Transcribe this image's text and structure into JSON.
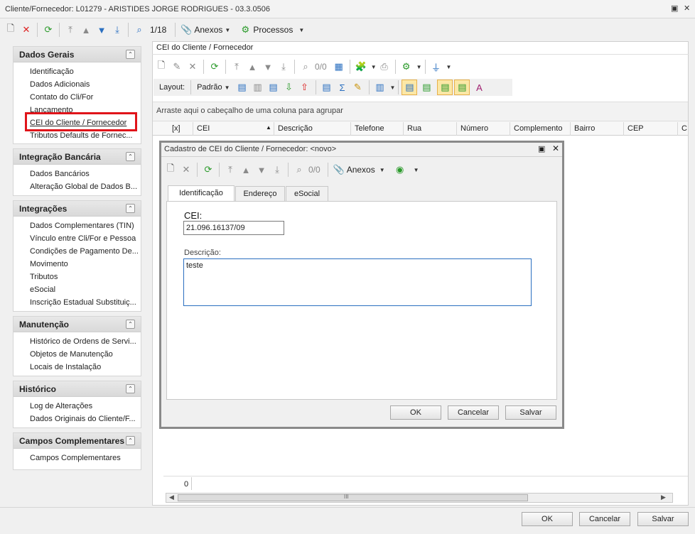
{
  "window": {
    "title": "Cliente/Fornecedor: L01279 - ARISTIDES JORGE RODRIGUES - 03.3.0506"
  },
  "toolbar": {
    "record_counter": "1/18",
    "attachments_label": "Anexos",
    "processes_label": "Processos"
  },
  "sidebar": {
    "groups": [
      {
        "title": "Dados Gerais",
        "items": [
          "Identificação",
          "Dados Adicionais",
          "Contato do Cli/For",
          "Lancamento",
          "CEI do Cliente  /  Fornecedor",
          "Tributos Defaults de Fornec..."
        ]
      },
      {
        "title": "Integração Bancária",
        "items": [
          "Dados Bancários",
          "Alteração Global de Dados B..."
        ]
      },
      {
        "title": "Integrações",
        "items": [
          "Dados Complementares (TIN)",
          "Vínculo entre Cli/For e Pessoa",
          "Condições de Pagamento De...",
          "Movimento",
          "Tributos",
          "eSocial",
          "Inscrição Estadual Substituiç..."
        ]
      },
      {
        "title": "Manutenção",
        "items": [
          "Histórico de Ordens de Servi...",
          "Objetos de Manutenção",
          "Locais de Instalação"
        ]
      },
      {
        "title": "Histórico",
        "items": [
          "Log de Alterações",
          "Dados Originais do Cliente/F..."
        ]
      },
      {
        "title": "Campos Complementares",
        "items": [
          "Campos Complementares"
        ]
      }
    ]
  },
  "panel": {
    "title": "CEI do Cliente  /  Fornecedor",
    "record_counter": "0/0",
    "layout_label": "Layout:",
    "layout_value": "Padrão",
    "group_hint": "Arraste aqui o cabeçalho de uma coluna para agrupar",
    "columns": [
      "[x]",
      "CEI",
      "Descrição",
      "Telefone",
      "Rua",
      "Número",
      "Complemento",
      "Bairro",
      "CEP",
      "C"
    ],
    "footer_count": "0",
    "scroll_thumb": "III"
  },
  "dialog": {
    "title": "Cadastro de CEI do Cliente / Fornecedor: <novo>",
    "record_counter": "0/0",
    "attachments_label": "Anexos",
    "tabs": [
      "Identificação",
      "Endereço",
      "eSocial"
    ],
    "cei_label": "CEI:",
    "cei_value": "21.096.16137/09",
    "descricao_label": "Descrição:",
    "descricao_value": "teste",
    "ok": "OK",
    "cancel": "Cancelar",
    "save": "Salvar"
  },
  "footer": {
    "ok": "OK",
    "cancel": "Cancelar",
    "save": "Salvar"
  },
  "colors": {
    "selection_border": "#e0141a",
    "field_border_focus": "#2a6fc0"
  }
}
